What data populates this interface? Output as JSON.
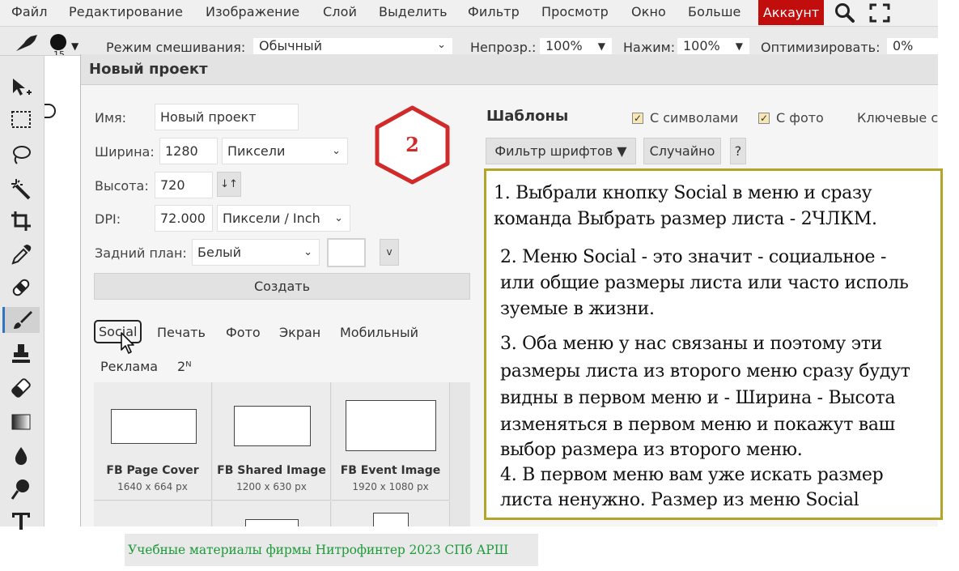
{
  "menubar": {
    "items": [
      "Файл",
      "Редактирование",
      "Изображение",
      "Слой",
      "Выделить",
      "Фильтр",
      "Просмотр",
      "Окно",
      "Больше"
    ],
    "account": "Аккаунт"
  },
  "options": {
    "brush_size": "15",
    "blend_label": "Режим смешивания:",
    "blend_value": "Обычный",
    "opacity_label": "Непрозр.:",
    "opacity_value": "100%",
    "pressure_label": "Нажим:",
    "pressure_value": "100%",
    "optimize_label": "Оптимизировать:",
    "optimize_value": "0%"
  },
  "tools": [
    "move-tool-icon",
    "marquee-icon",
    "lasso-icon",
    "magic-wand-icon",
    "crop-icon",
    "eyedropper-icon",
    "healing-icon",
    "brush-icon",
    "stamp-icon",
    "eraser-icon",
    "gradient-icon",
    "blur-icon",
    "dodge-icon",
    "text-icon"
  ],
  "dialog": {
    "title": "Новый проект",
    "name_label": "Имя:",
    "name_value": "Новый проект",
    "width_label": "Ширина:",
    "width_value": "1280",
    "width_unit": "Пиксели",
    "height_label": "Высота:",
    "height_value": "720",
    "swap_icon": "↓↑",
    "dpi_label": "DPI:",
    "dpi_value": "72.000",
    "dpi_unit": "Пиксели / Inch",
    "bg_label": "Задний план:",
    "bg_value": "Белый",
    "bg_color_button": "v",
    "create_button": "Создать",
    "tabs": [
      "Social",
      "Печать",
      "Фото",
      "Экран",
      "Мобильный",
      "Реклама",
      "2ᴺ"
    ],
    "presets": [
      {
        "name": "FB Page Cover",
        "size": "1640 x 664 px"
      },
      {
        "name": "FB Shared Image",
        "size": "1200 x 630 px"
      },
      {
        "name": "FB Event Image",
        "size": "1920 x 1080 px"
      }
    ],
    "templates": {
      "title": "Шаблоны",
      "opt_symbols": "С символами",
      "opt_photo": "С фото",
      "keywords": "Ключевые с",
      "font_filter": "Фильтр шрифтов ▼",
      "random": "Случайно",
      "help": "?"
    }
  },
  "annotation": {
    "badge": "2",
    "lines": [
      "1. Выбрали кнопку Social в меню и сразу",
      "команда Выбрать размер листа - 2ЧЛКМ.",
      "2. Меню Social - это значит - социальное -",
      "или общие размеры листа или часто исполь",
      "зуемые в жизни.",
      "3. Оба меню у нас связаны и поэтому эти",
      "размеры листа из второго меню сразу будут",
      "видны в первом меню и - Ширина - Высота",
      "изменяться в первом меню и покажут ваш",
      "выбор размера из второго меню.",
      "4. В первом меню вам уже искать размер",
      "листа ненужно. Размер из меню Social"
    ],
    "footer": "Учебные материалы фирмы Нитрофинтер 2023 СПб АРШ"
  }
}
